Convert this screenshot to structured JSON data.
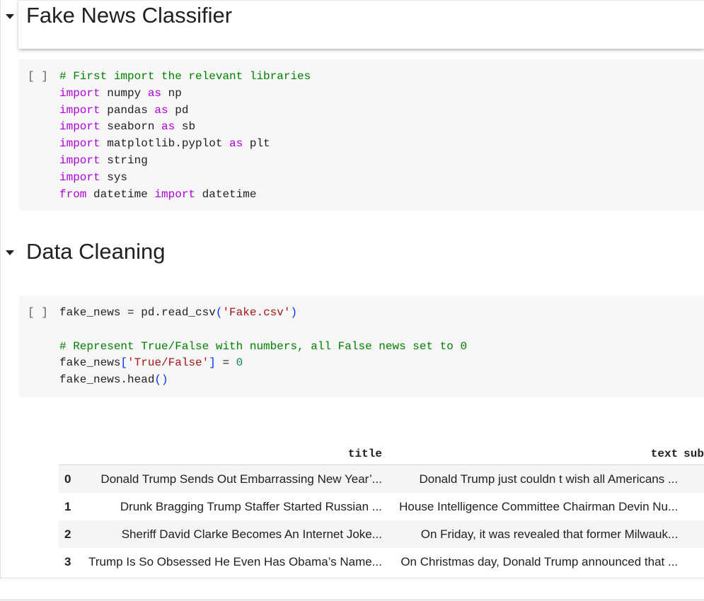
{
  "sections": [
    {
      "title": "Fake News Classifier"
    },
    {
      "title": "Data Cleaning"
    }
  ],
  "cells": [
    {
      "indicator": "[ ]"
    },
    {
      "indicator": "[ ]"
    }
  ],
  "dataframe": {
    "columns": [
      "title",
      "text",
      "sub"
    ],
    "rows": [
      {
        "index": "0",
        "title": "Donald Trump Sends Out Embarrassing New Year’...",
        "text": "Donald Trump just couldn t wish all Americans ..."
      },
      {
        "index": "1",
        "title": "Drunk Bragging Trump Staffer Started Russian ...",
        "text": "House Intelligence Committee Chairman Devin Nu..."
      },
      {
        "index": "2",
        "title": "Sheriff David Clarke Becomes An Internet Joke...",
        "text": "On Friday, it was revealed that former Milwauk..."
      },
      {
        "index": "3",
        "title": "Trump Is So Obsessed He Even Has Obama’s Name...",
        "text": "On Christmas day, Donald Trump announced that ..."
      }
    ]
  },
  "colors": {
    "keyword": "#af00db",
    "comment": "#008000",
    "string": "#a31515",
    "number": "#098658",
    "bracket": "#0431fa"
  }
}
